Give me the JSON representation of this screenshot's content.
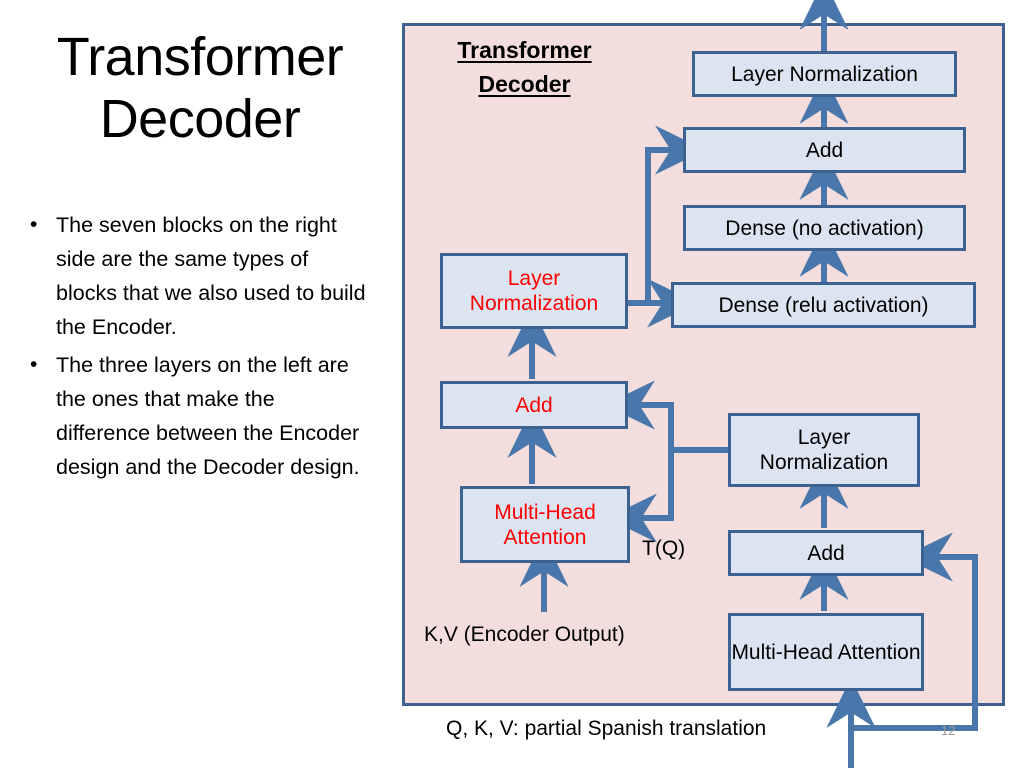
{
  "slide": {
    "title": "Transformer Decoder",
    "page_number": "12",
    "bullets": [
      {
        "marker": "•",
        "text": "The seven blocks on the right side are the same types of blocks that we also used to build the Encoder."
      },
      {
        "marker": "•",
        "text": "The three layers on the left are the ones that make the difference between the Encoder design and the Decoder design."
      }
    ]
  },
  "diagram": {
    "title": "Transformer Decoder",
    "panel_fill": "#f3dedd",
    "panel_border": "#40618f",
    "block_fill": "#dce4f1",
    "block_border": "#3c6292",
    "arrow_color": "#4a77ab",
    "highlight_text_color": "#ff0000",
    "blocks": [
      {
        "id": "ln_top",
        "label": "Layer Normalization",
        "red": false
      },
      {
        "id": "add_top",
        "label": "Add",
        "red": false
      },
      {
        "id": "dense_noact",
        "label": "Dense (no activation)",
        "red": false
      },
      {
        "id": "dense_relu",
        "label": "Dense (relu activation)",
        "red": false
      },
      {
        "id": "ln_left",
        "label": "Layer Normalization",
        "red": true
      },
      {
        "id": "add_left",
        "label": "Add",
        "red": true
      },
      {
        "id": "mha_left",
        "label": "Multi-Head Attention",
        "red": true
      },
      {
        "id": "ln_mid",
        "label": "Layer Normalization",
        "red": false
      },
      {
        "id": "add_bottom",
        "label": "Add",
        "red": false
      },
      {
        "id": "mha_bottom",
        "label": "Multi-Head Attention",
        "red": false
      }
    ],
    "labels": [
      {
        "id": "tq",
        "text": "T(Q)"
      },
      {
        "id": "kv",
        "text": "K,V (Encoder Output)"
      },
      {
        "id": "qkv_note",
        "text": "Q, K, V: partial Spanish translation"
      }
    ]
  }
}
